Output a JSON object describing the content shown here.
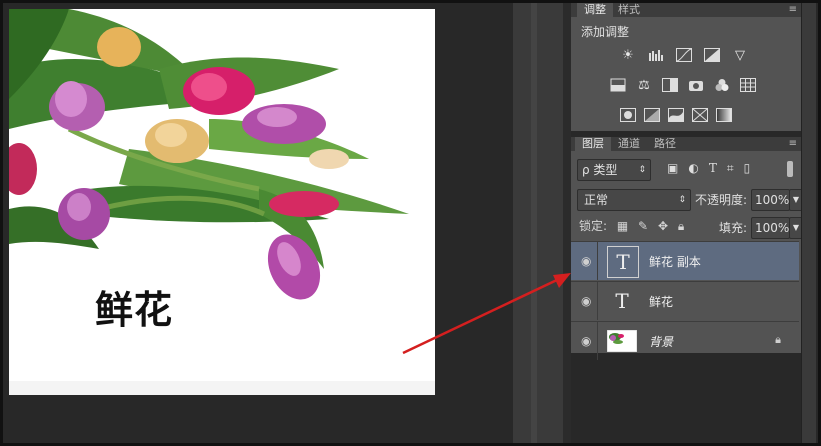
{
  "canvas": {
    "text": "鲜花"
  },
  "adjustments_panel": {
    "tabs": [
      "调整",
      "样式"
    ],
    "title": "添加调整",
    "icons_row1": [
      "brightness-icon",
      "levels-icon",
      "curves-icon",
      "exposure-icon",
      "vibrance-icon"
    ],
    "icons_row2": [
      "hue-saturation-icon",
      "color-balance-icon",
      "black-white-icon",
      "photo-filter-icon",
      "channel-mixer-icon",
      "color-lookup-icon"
    ],
    "icons_row3": [
      "invert-icon",
      "posterize-icon",
      "threshold-icon",
      "selective-color-icon",
      "gradient-map-icon"
    ]
  },
  "layers_panel": {
    "tabs": [
      "图层",
      "通道",
      "路径"
    ],
    "filter_label": "ρ 类型",
    "blend_mode": "正常",
    "opacity_label": "不透明度:",
    "opacity_value": "100%",
    "lock_label": "锁定:",
    "fill_label": "填充:",
    "fill_value": "100%",
    "layers": [
      {
        "name": "鲜花 副本",
        "type": "text",
        "selected": true
      },
      {
        "name": "鲜花",
        "type": "text",
        "selected": false
      },
      {
        "name": "背景",
        "type": "image",
        "selected": false,
        "locked": true
      }
    ]
  },
  "colors": {
    "arrow": "#d41f1f",
    "selected_layer": "#5e6b80",
    "panel_bg": "#535353"
  }
}
